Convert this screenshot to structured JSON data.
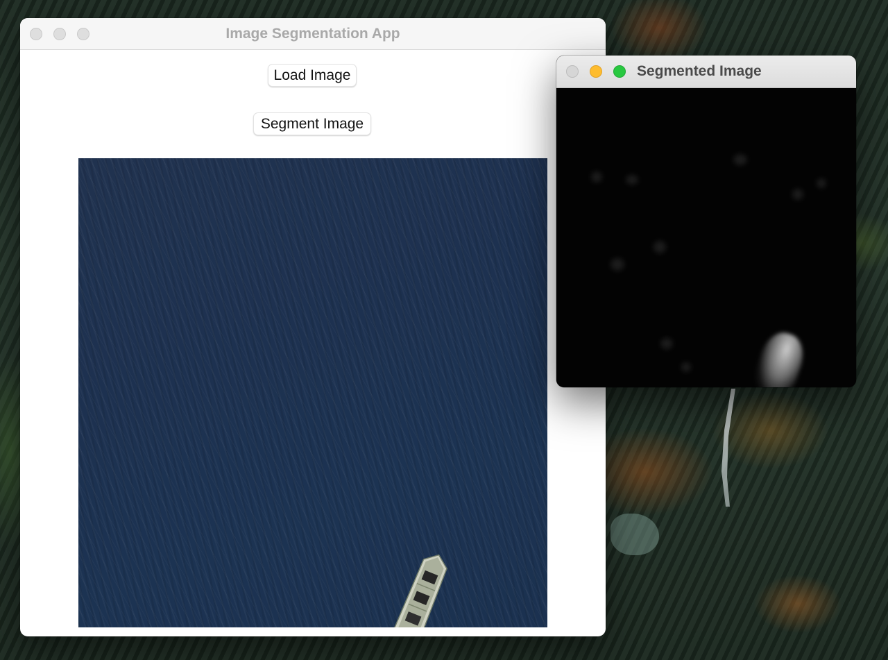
{
  "main_window": {
    "title": "Image Segmentation App",
    "buttons": {
      "load_label": "Load Image",
      "segment_label": "Segment Image"
    },
    "image": {
      "content": "ocean-with-ship",
      "water_color": "#1e3250"
    }
  },
  "segmented_window": {
    "title": "Segmented Image",
    "image": {
      "content": "segmentation-mask",
      "background_color": "#030303",
      "mask_color": "#d7d7d7"
    }
  },
  "colors": {
    "traffic_close_inactive": "#dedede",
    "traffic_minimize": "#febc2e",
    "traffic_zoom": "#28c840",
    "title_text_inactive": "#a9a9a9",
    "title_text_active": "#4a4a4a"
  }
}
